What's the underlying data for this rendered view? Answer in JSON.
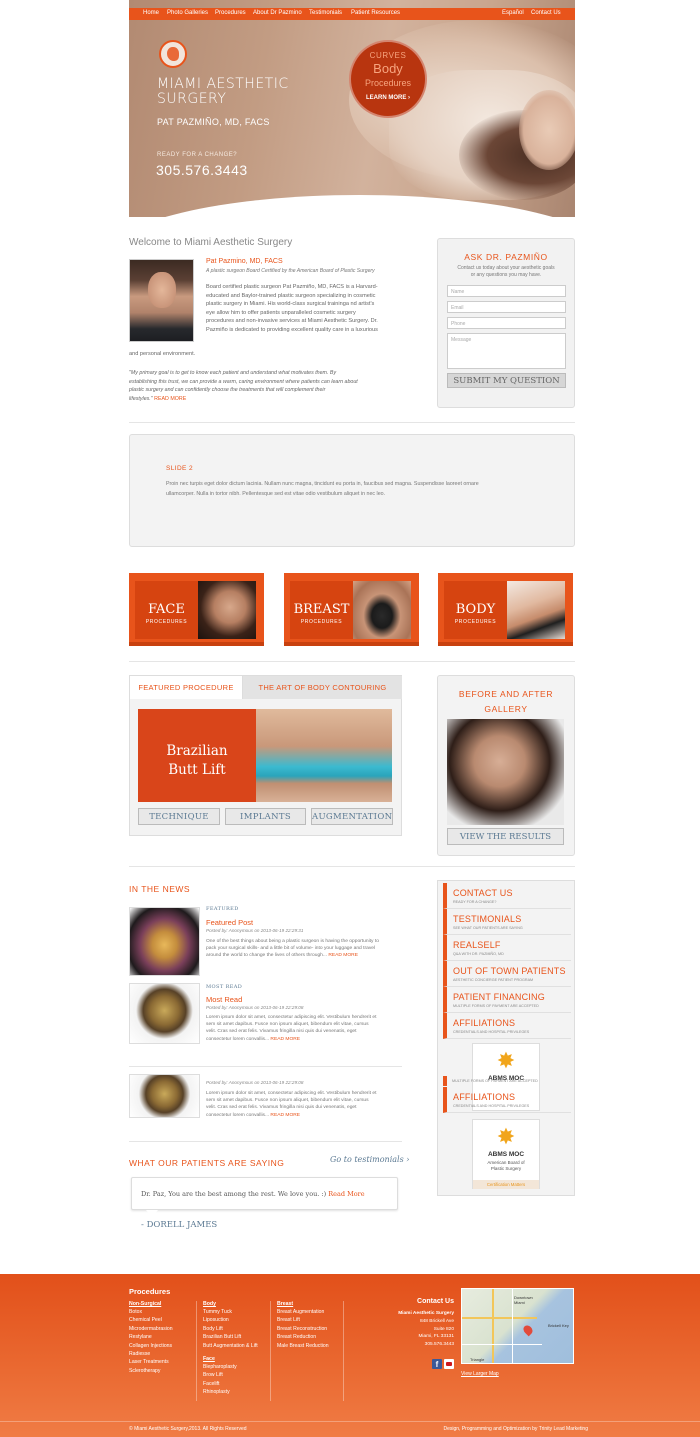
{
  "nav": {
    "home": "Home",
    "photo_galleries": "Photo Galleries",
    "procedures": "Procedures",
    "about": "About Dr Pazmino",
    "testimonials": "Testimonials",
    "patient_resources": "Patient Resources",
    "espanol": "Español",
    "contact": "Contact Us"
  },
  "hero": {
    "title_line1": "MIAMI AESTHETIC",
    "title_line2": "SURGERY",
    "doctor": "PAT PAZMIÑO, MD, FACS",
    "ready": "READY FOR A CHANGE?",
    "phone": "305.576.3443",
    "promo_curves": "CURVES",
    "promo_body": "Body",
    "promo_procedures": "Procedures",
    "promo_cta": "LEARN MORE ›"
  },
  "welcome": {
    "heading": "Welcome to Miami Aesthetic Surgery",
    "name": "Pat Pazmino, MD, FACS",
    "credential": "A plastic surgeon Board Certified by the American Board of Plastic Surgery",
    "bio_lines": [
      "Board certified plastic surgeon Pat Pazmiño, MD, FACS is a Harvard-",
      "educated and Baylor-trained plastic surgeon specializing in cosmetic",
      "plastic surgery in Miami. His world-class surgical trainingа nd artist's",
      "eye allow him to offer patients unparalleled cosmetic surgery",
      "procedures and non-invasive services at Miami Aesthetic Surgery. Dr.",
      "Pazmiño is dedicated to providing excellent quality care in a luxurious",
      "and personal environment."
    ],
    "quote_lines": [
      "\"My primary goal is to get to know each patient and understand what motivates them. By",
      "establishing this trust, we can provide a warm, caring environment where patients can learn about",
      "plastic surgery and can confidently choose the treatments that will complement their"
    ],
    "quote_end": "lifestyles.\"",
    "read_more": "READ MORE"
  },
  "ask": {
    "title": "ASK DR. PAZMIÑO",
    "intro_line1": "Contact us today about your aesthetic goals",
    "intro_line2": "or any questions you may have.",
    "name_placeholder": "Name",
    "email_placeholder": "Email",
    "phone_placeholder": "Phone",
    "message_placeholder": "Message",
    "submit": "SUBMIT MY QUESTION"
  },
  "slide": {
    "title": "SLIDE 2",
    "line1": "Proin nec turpis eget dolor dictum lacinia. Nullam nunc magna, tincidunt eu porta in, faucibus sed magna. Suspendisse laoreet ornare",
    "line2": "ullamcorper. Nulla in tortor nibh. Pellentesque sed est vitae odio vestibulum aliquet in nec leo."
  },
  "tiles": [
    {
      "title": "FACE",
      "sub": "PROCEDURES"
    },
    {
      "title": "BREAST",
      "sub": "PROCEDURES"
    },
    {
      "title": "BODY",
      "sub": "PROCEDURES"
    }
  ],
  "featured": {
    "tab1": "FEATURED PROCEDURE",
    "tab2": "THE ART OF BODY CONTOURING",
    "banner_line1": "Brazilian",
    "banner_line2": "Butt Lift",
    "btn1": "TECHNIQUE",
    "btn2": "IMPLANTS",
    "btn3": "AUGMENTATION"
  },
  "before_after": {
    "title_line1": "BEFORE AND AFTER",
    "title_line2": "GALLERY",
    "button": "VIEW THE RESULTS"
  },
  "news": {
    "heading": "IN THE NEWS",
    "items": [
      {
        "tag": "FEATURED",
        "title": "Featured Post",
        "meta": "Posted by: Anonymous on 2013-06-19 22:29:31",
        "lines": [
          "One of the best things about being a plastic surgeon is having the opportunity to",
          "pack your surgical skills- and a little bit of volume- into your luggage and travel",
          "around the world to change the lives of others through..."
        ],
        "more": "READ MORE"
      },
      {
        "tag": "MOST READ",
        "title": "Most Read",
        "meta": "Posted by: Anonymous on 2013-06-19 22:29:08",
        "lines": [
          "Lorem ipsum dolor sit amet, consectetur adipiscing elit. Vestibulum hendrerit et",
          "sem sit amet dapibus. Fusce non ipsum aliquet, bibendum elit vitae, cursus",
          "velit. Cras sed erat felis. Vivamus fringilla nisi quis dui venenatis, eget",
          "consectetur lorem convallis..."
        ],
        "more": "READ MORE"
      },
      {
        "tag": "",
        "title": "",
        "meta": "Posted by: Anonymous on 2013-06-19 22:29:08",
        "lines": [
          "Lorem ipsum dolor sit amet, consectetur adipiscing elit. Vestibulum hendrerit et",
          "sem sit amet dapibus. Fusce non ipsum aliquet, bibendum elit vitae, cursus",
          "velit. Cras sed erat felis. Vivamus fringilla nisi quis dui venenatis, eget",
          "consectetur lorem convallis..."
        ],
        "more": "READ MORE"
      }
    ]
  },
  "sidebar": {
    "items": [
      {
        "title": "CONTACT US",
        "sub": "READY FOR A CHANGE?"
      },
      {
        "title": "TESTIMONIALS",
        "sub": "SEE WHAT OUR PATIENTS ARE SAYING"
      },
      {
        "title": "REALSELF",
        "sub": "Q&A WITH DR. PAZMIÑO, MD"
      },
      {
        "title": "OUT OF TOWN PATIENTS",
        "sub": "AESTHETIC CONCIERGE PATIENT PROGRAM"
      },
      {
        "title": "PATIENT FINANCING",
        "sub": "MULTIPLE FORMS OF PAYMENT ARE ACCEPTED"
      },
      {
        "title": "AFFILIATIONS",
        "sub": "CREDENTIALS AND HOSPITAL PRIVILEGES"
      }
    ],
    "overlap_sub": "MULTIPLE FORMS OF PAYMENT ARE ACCEPTED",
    "affiliations2_title": "AFFILIATIONS",
    "affiliations2_sub": "CREDENTIALS AND HOSPITAL PRIVILEGES",
    "abms_name": "ABMS MOC",
    "abms_line1": "American Board of",
    "abms_line2": "Plastic Surgery",
    "abms_link": "Certification Matters"
  },
  "testimonials": {
    "heading": "WHAT OUR PATIENTS ARE SAYING",
    "go_link": "Go to testimonials ›",
    "quote": "Dr. Paz, You are the best among the rest. We love you. :)",
    "read_more": "Read More",
    "author": "- DORELL JAMES"
  },
  "footer": {
    "procedures_heading": "Procedures",
    "nonsurgical_heading": "Non-Surgical",
    "nonsurgical": [
      "Botox",
      "Chemical Peel",
      "Microdermabrasion",
      "Restylane",
      "Collagen Injections",
      "Radiesse",
      "Laser Treatments",
      "Sclerotherapy"
    ],
    "body_heading": "Body",
    "body": [
      "Tummy Tuck",
      "Liposuction",
      "Body Lift",
      "Brazilian Butt Lift",
      "Butt Augmentation & Lift"
    ],
    "face_heading": "Face",
    "face": [
      "Blepharoplasty",
      "Brow Lift",
      "Facelift",
      "Rhinoplasty"
    ],
    "breast_heading": "Breast",
    "breast": [
      "Breast Augmentation",
      "Breast Lift",
      "Breast Reconstruction",
      "Breast Reduction",
      "Male Breast Reduction"
    ],
    "contact_heading": "Contact Us",
    "contact_lines": [
      "Miami Aesthetic Surgery",
      "848 Brickell Ave",
      "Suite 820",
      "Miami, FL 33131",
      "305.576.3443"
    ],
    "map_label": "Downtown Miami",
    "map_label2": "Brickell Key",
    "map_label3": "Triangle",
    "view_larger": "View Larger Map",
    "copyright": "© Miami Aesthetic Surgery,2013. All Rights Reserved",
    "credit": "Design, Programming and Optimization by Trinity Lead Marketing"
  },
  "colors": {
    "accent": "#e8541b",
    "link_blue": "#5c7a93"
  }
}
